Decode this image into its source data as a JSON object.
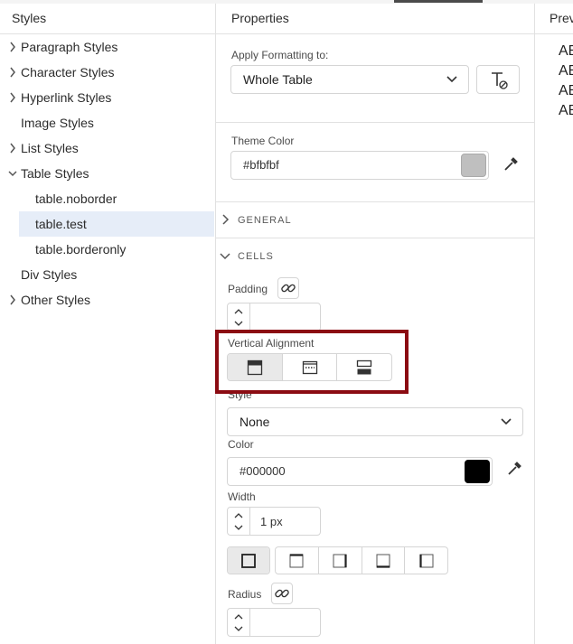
{
  "styles_panel": {
    "title": "Styles",
    "items": [
      {
        "label": "Paragraph Styles",
        "expandable": true
      },
      {
        "label": "Character Styles",
        "expandable": true
      },
      {
        "label": "Hyperlink Styles",
        "expandable": true
      },
      {
        "label": "Image Styles",
        "expandable": false
      },
      {
        "label": "List Styles",
        "expandable": true
      },
      {
        "label": "Table Styles",
        "expandable": true,
        "expanded": true
      },
      {
        "label": "table.noborder",
        "child": true
      },
      {
        "label": "table.test",
        "child": true,
        "selected": true
      },
      {
        "label": "table.borderonly",
        "child": true
      },
      {
        "label": "Div Styles",
        "expandable": false
      },
      {
        "label": "Other Styles",
        "expandable": true
      }
    ]
  },
  "properties_panel": {
    "title": "Properties",
    "apply_formatting_label": "Apply Formatting to:",
    "apply_formatting_value": "Whole Table",
    "theme_color_label": "Theme Color",
    "theme_color_value": "#bfbfbf",
    "general_section": "GENERAL",
    "cells_section": "CELLS",
    "padding_label": "Padding",
    "padding_value": "",
    "vertical_alignment_label": "Vertical Alignment",
    "vertical_alignment_selected": "top",
    "style_label": "Style",
    "style_value": "None",
    "color_label": "Color",
    "color_value": "#000000",
    "width_label": "Width",
    "width_value": "1 px",
    "radius_label": "Radius",
    "radius_value": ""
  },
  "preview_panel": {
    "title": "Preview",
    "lines": [
      "AB",
      "AB",
      "AB",
      "AB"
    ]
  },
  "colors": {
    "accent_highlight": "#8b0b12",
    "selected_row": "#e6edf8",
    "theme_swatch": "#bfbfbf",
    "border_swatch": "#000000"
  }
}
